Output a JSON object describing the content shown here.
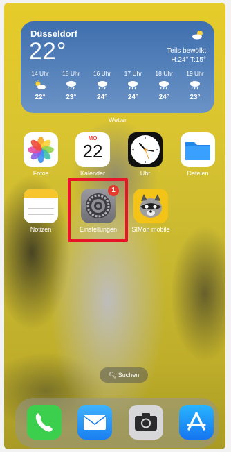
{
  "weather": {
    "city": "Düsseldorf",
    "temp": "22°",
    "condition": "Teils bewölkt",
    "high_low": "H:24° T:15°",
    "hours": [
      {
        "time": "14 Uhr",
        "icon": "partly-cloudy-icon",
        "temp": "22°"
      },
      {
        "time": "15 Uhr",
        "icon": "rain-icon",
        "temp": "23°"
      },
      {
        "time": "16 Uhr",
        "icon": "rain-icon",
        "temp": "24°"
      },
      {
        "time": "17 Uhr",
        "icon": "rain-icon",
        "temp": "24°"
      },
      {
        "time": "18 Uhr",
        "icon": "rain-icon",
        "temp": "24°"
      },
      {
        "time": "19 Uhr",
        "icon": "rain-icon",
        "temp": "23°"
      }
    ],
    "widget_label": "Wetter"
  },
  "calendar": {
    "weekday": "MO",
    "day": "22"
  },
  "apps": [
    {
      "label": "Fotos",
      "icon": "photos-icon"
    },
    {
      "label": "Kalender",
      "icon": "calendar-icon"
    },
    {
      "label": "Uhr",
      "icon": "clock-icon"
    },
    {
      "label": "Dateien",
      "icon": "files-icon"
    },
    {
      "label": "Notizen",
      "icon": "notes-icon"
    },
    {
      "label": "Einstellungen",
      "icon": "settings-gear-icon",
      "badge": "1"
    },
    {
      "label": "SIMon mobile",
      "icon": "raccoon-icon"
    }
  ],
  "search": {
    "label": "Suchen",
    "icon": "search-icon"
  },
  "dock": [
    {
      "icon": "phone-icon"
    },
    {
      "icon": "mail-icon"
    },
    {
      "icon": "camera-icon"
    },
    {
      "icon": "app-store-icon"
    }
  ],
  "colors": {
    "highlight": "#e8152a",
    "badge": "#e8392f",
    "widget_top": "#3f6fae"
  }
}
